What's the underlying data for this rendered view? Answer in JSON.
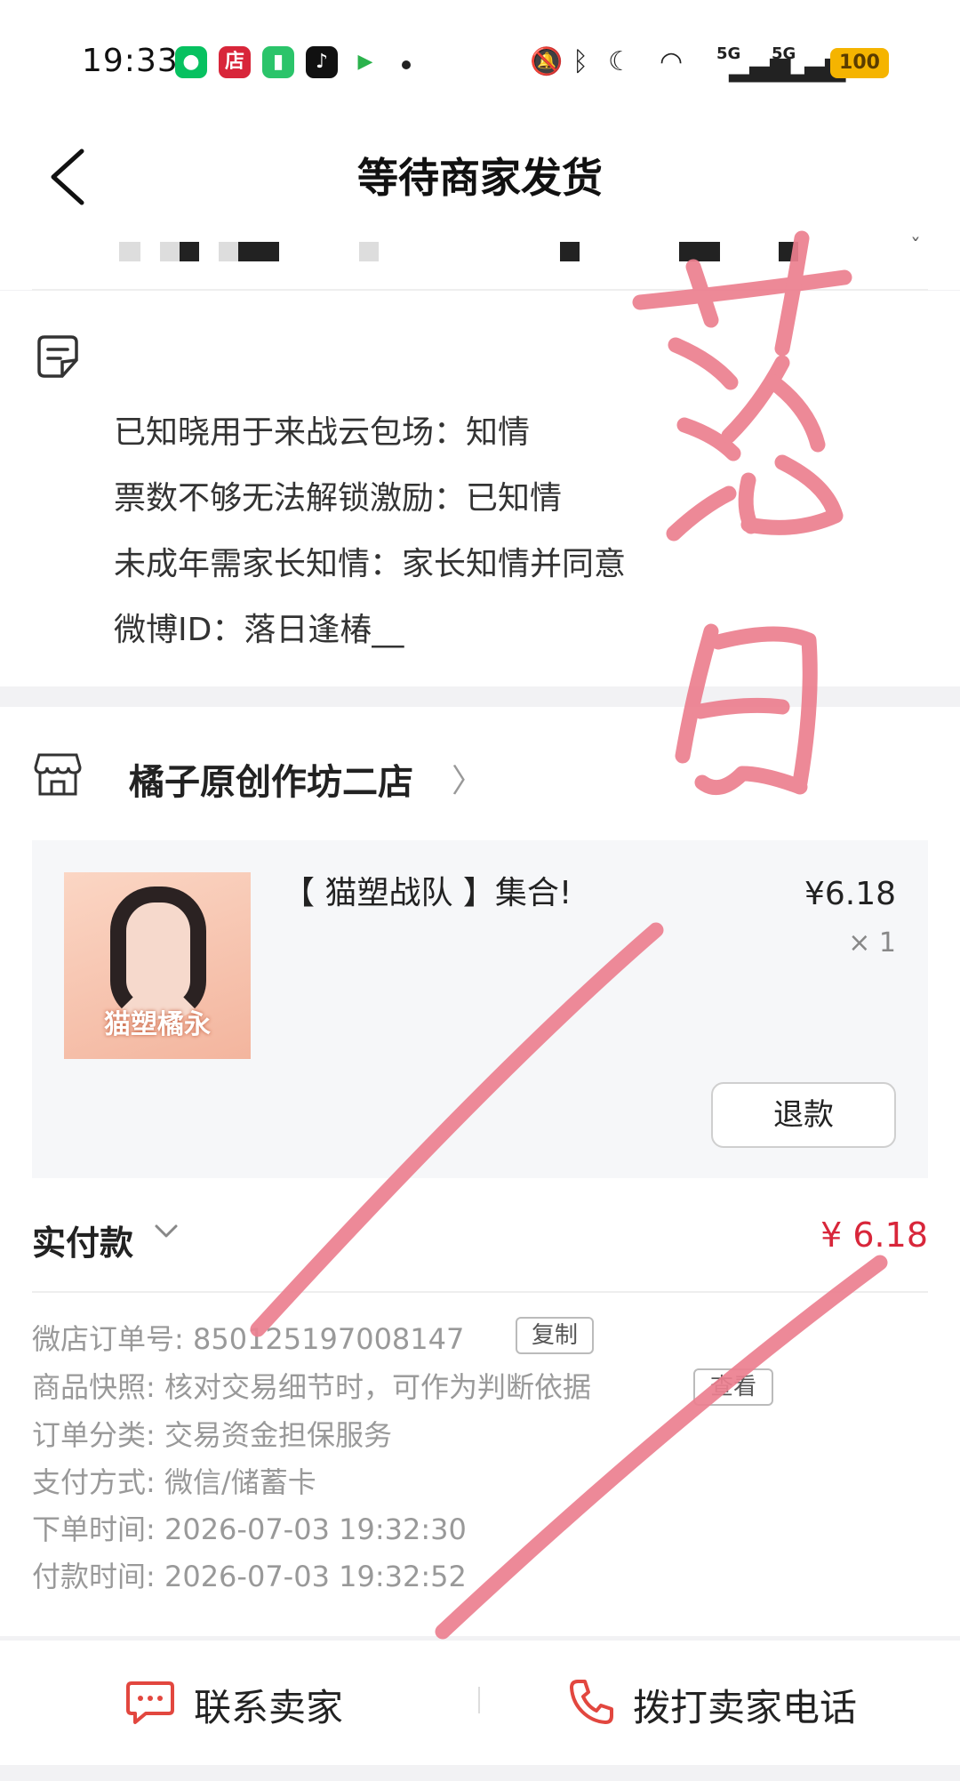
{
  "status_bar": {
    "time": "19:33",
    "app_icons": [
      "wechat-icon",
      "shop-app-icon",
      "battery-app-icon",
      "tiktok-icon",
      "video-app-icon"
    ],
    "shop_app_glyph": "店",
    "network_5g_1": "5G",
    "network_5g_2": "5G",
    "battery": "100"
  },
  "header": {
    "title": "等待商家发货"
  },
  "notes": {
    "lines": [
      "已知晓用于来战云包场：知情",
      "票数不够无法解锁激励：已知情",
      "未成年需家长知情：家长知情并同意",
      "微博ID：落日逢椿__"
    ]
  },
  "shop": {
    "name": "橘子原创作坊二店",
    "product": {
      "thumb_text": "猫塑橘永",
      "name": "【 猫塑战队 】集合!",
      "price": "¥6.18",
      "qty": "× 1",
      "refund_label": "退款"
    },
    "paid_label": "实付款",
    "paid_amount": "¥ 6.18"
  },
  "order_info": {
    "order_no_label": "微店订单号:",
    "order_no": "850125197008147",
    "copy_label": "复制",
    "snapshot_label": "商品快照:",
    "snapshot_text": "核对交易细节时，可作为判断依据",
    "view_label": "查看",
    "category_label": "订单分类:",
    "category": "交易资金担保服务",
    "payment_label": "支付方式:",
    "payment": "微信/储蓄卡",
    "order_time_label": "下单时间:",
    "order_time": "2026-07-03 19:32:30",
    "pay_time_label": "付款时间:",
    "pay_time": "2026-07-03 19:32:52"
  },
  "bottom_bar": {
    "contact_label": "联系卖家",
    "call_label": "拨打卖家电话"
  },
  "colors": {
    "price_red": "#d8263a",
    "handwriting_pink": "#ec7f8f",
    "battery_yellow": "#f5b400"
  },
  "handwriting": "落日"
}
